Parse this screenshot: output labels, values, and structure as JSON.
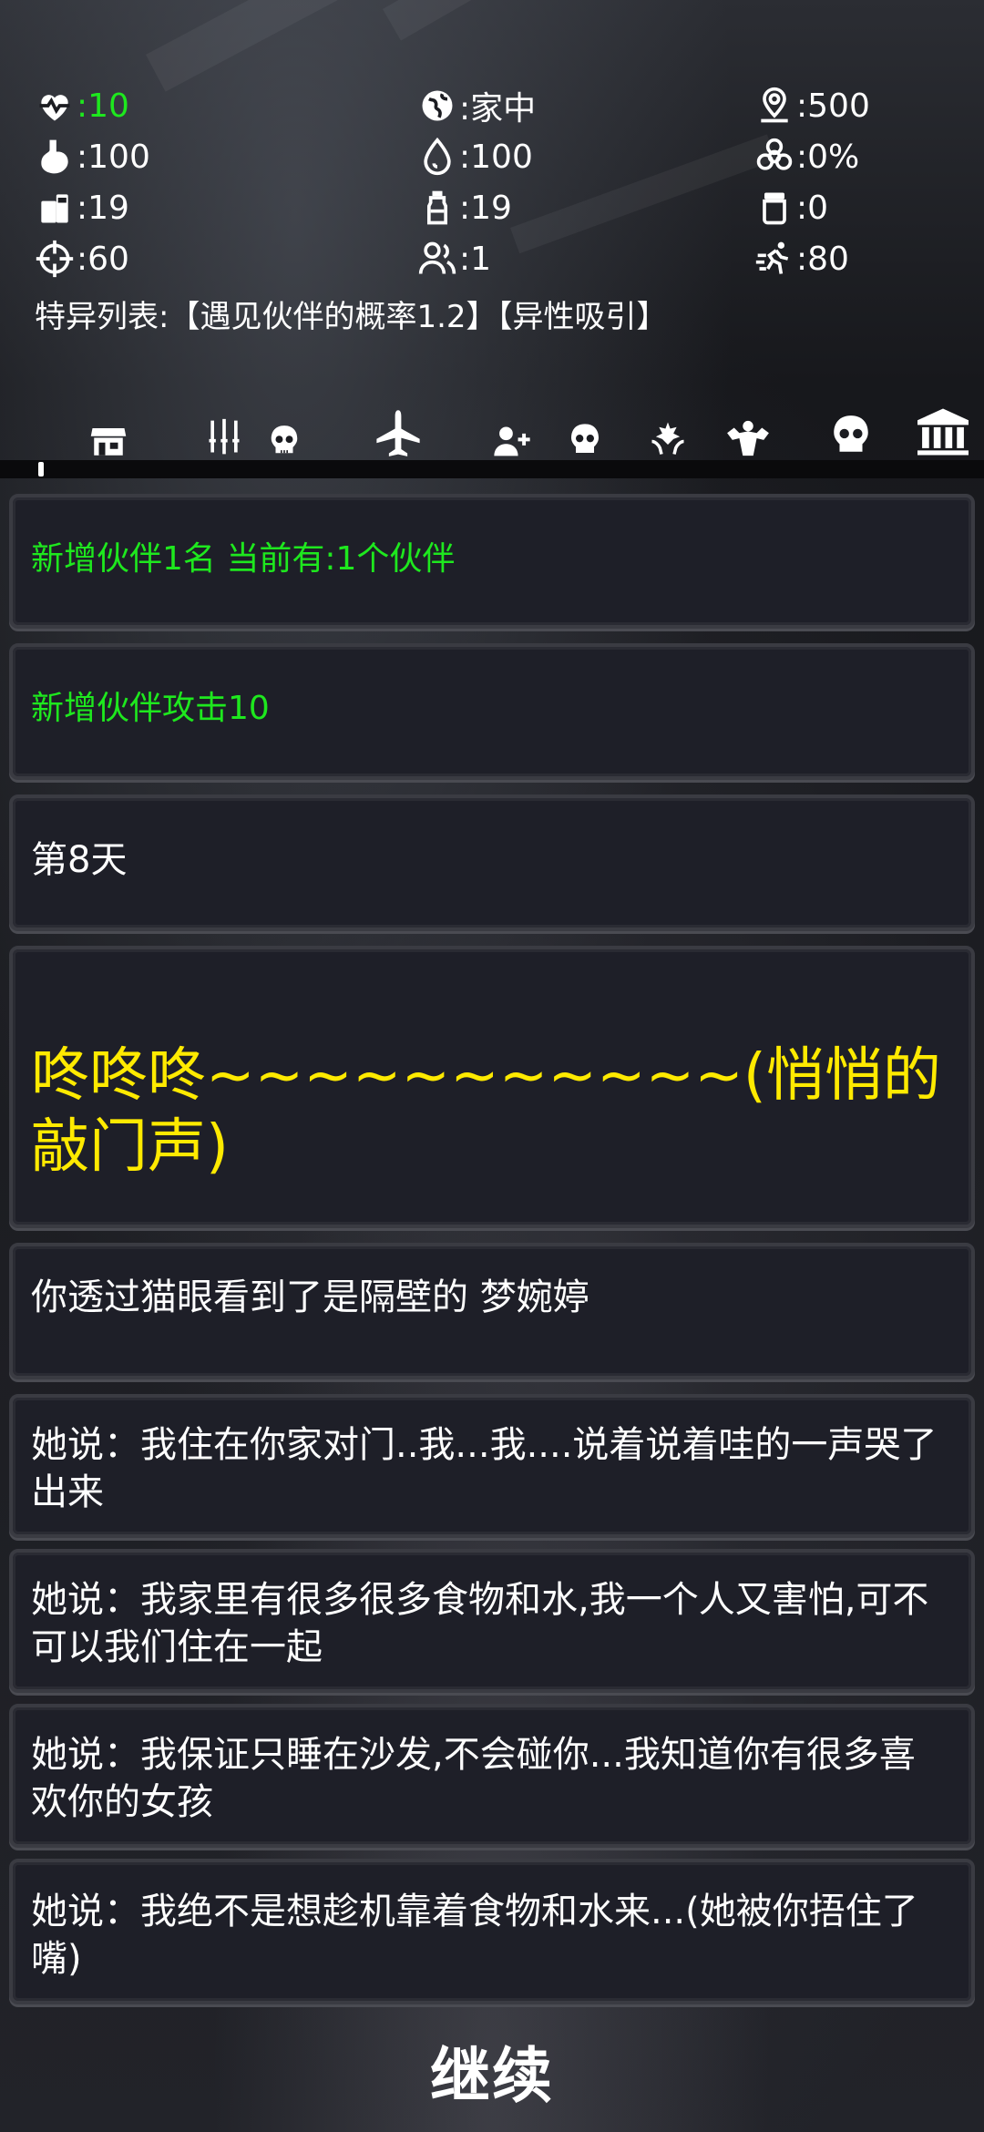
{
  "stats": {
    "health": {
      "icon": "heartbeat-icon",
      "value": ":10"
    },
    "location": {
      "icon": "globe-icon",
      "value": ":家中"
    },
    "distance": {
      "icon": "map-pin-icon",
      "value": ":500"
    },
    "hunger": {
      "icon": "stomach-icon",
      "value": ":100"
    },
    "water": {
      "icon": "water-drop-icon",
      "value": ":100"
    },
    "infection": {
      "icon": "biohazard-icon",
      "value": ":0%"
    },
    "food": {
      "icon": "canned-food-icon",
      "value": ":19"
    },
    "bottle": {
      "icon": "water-bottle-icon",
      "value": ":19"
    },
    "jar": {
      "icon": "jar-icon",
      "value": ":0"
    },
    "attack": {
      "icon": "crosshair-icon",
      "value": ":60"
    },
    "companions": {
      "icon": "companions-icon",
      "value": ":1"
    },
    "speed": {
      "icon": "runner-icon",
      "value": ":80"
    }
  },
  "traits": "特异列表:【遇见伙伴的概率1.2】【异性吸引】",
  "toolbar": [
    "shop-icon",
    "weapons-icon",
    "skull-icon",
    "airplane-icon",
    "add-user-icon",
    "skull-icon",
    "blessing-icon",
    "strength-icon",
    "skull-icon",
    "bank-icon"
  ],
  "log": [
    {
      "text": "新增伙伴1名  当前有:1个伙伴",
      "style": "green"
    },
    {
      "text": "新增伙伴攻击10",
      "style": "green"
    },
    {
      "text": "第8天",
      "style": "white"
    },
    {
      "text": "咚咚咚~~~~~~~~~~~(悄悄的敲门声)",
      "style": "yellow"
    },
    {
      "text": "你透过猫眼看到了是隔壁的 梦婉婷",
      "style": "white"
    },
    {
      "text": "她说：我住在你家对门..我...我....说着说着哇的一声哭了出来",
      "style": "white"
    },
    {
      "text": "她说：我家里有很多很多食物和水,我一个人又害怕,可不可以我们住在一起",
      "style": "white"
    },
    {
      "text": "她说：我保证只睡在沙发,不会碰你...我知道你有很多喜欢你的女孩",
      "style": "white"
    },
    {
      "text": "她说：我绝不是想趁机靠着食物和水来...(她被你捂住了嘴)",
      "style": "white"
    }
  ],
  "continue_label": "继续",
  "colors": {
    "green": "#1ee81e",
    "yellow": "#ffea00",
    "card": "#1e1f28"
  }
}
